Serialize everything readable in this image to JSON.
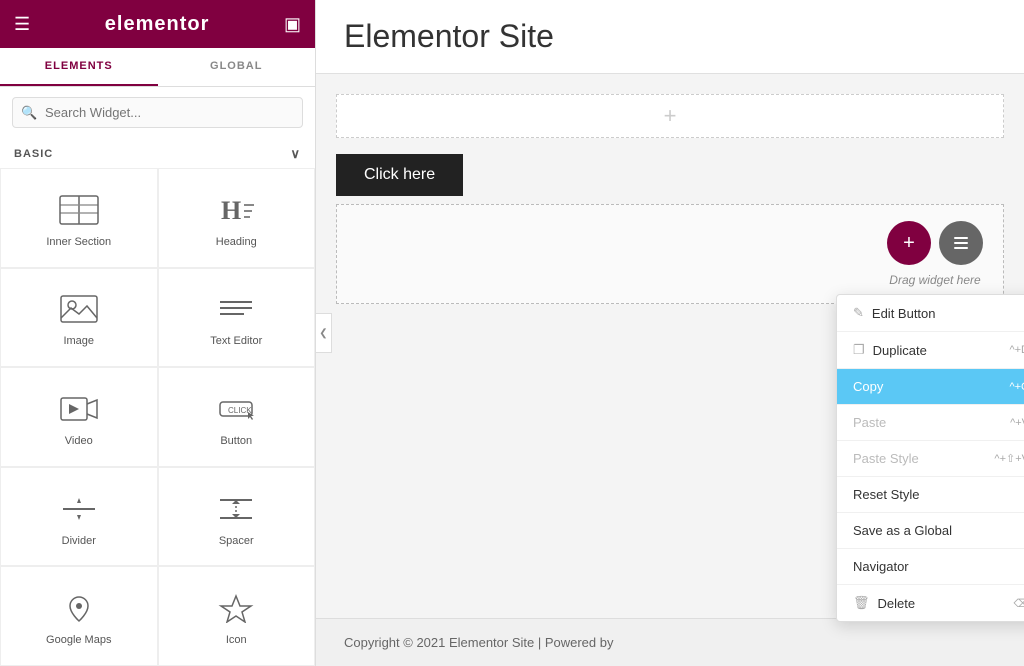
{
  "sidebar": {
    "logo": "elementor",
    "tabs": [
      {
        "id": "elements",
        "label": "ELEMENTS",
        "active": true
      },
      {
        "id": "global",
        "label": "GLOBAL",
        "active": false
      }
    ],
    "search": {
      "placeholder": "Search Widget..."
    },
    "section_label": "BASIC",
    "widgets": [
      {
        "id": "inner-section",
        "label": "Inner Section",
        "icon": "inner-section-icon"
      },
      {
        "id": "heading",
        "label": "Heading",
        "icon": "heading-icon"
      },
      {
        "id": "image",
        "label": "Image",
        "icon": "image-icon"
      },
      {
        "id": "text-editor",
        "label": "Text Editor",
        "icon": "text-editor-icon"
      },
      {
        "id": "video",
        "label": "Video",
        "icon": "video-icon"
      },
      {
        "id": "button",
        "label": "Button",
        "icon": "button-icon"
      },
      {
        "id": "divider",
        "label": "Divider",
        "icon": "divider-icon"
      },
      {
        "id": "spacer",
        "label": "Spacer",
        "icon": "spacer-icon"
      },
      {
        "id": "google-maps",
        "label": "Google Maps",
        "icon": "map-icon"
      },
      {
        "id": "icon",
        "label": "Icon",
        "icon": "icon-icon"
      }
    ]
  },
  "main": {
    "title": "Elementor Site",
    "canvas": {
      "add_section_plus": "+",
      "button_label": "Click here",
      "drag_label": "Drag widget here"
    },
    "context_menu": {
      "items": [
        {
          "id": "edit-button",
          "label": "Edit Button",
          "shortcut": "",
          "icon": "edit-icon",
          "active": false,
          "disabled": false
        },
        {
          "id": "duplicate",
          "label": "Duplicate",
          "shortcut": "^+D",
          "icon": "duplicate-icon",
          "active": false,
          "disabled": false
        },
        {
          "id": "copy",
          "label": "Copy",
          "shortcut": "^+C",
          "icon": "",
          "active": true,
          "disabled": false
        },
        {
          "id": "paste",
          "label": "Paste",
          "shortcut": "^+V",
          "icon": "",
          "active": false,
          "disabled": true
        },
        {
          "id": "paste-style",
          "label": "Paste Style",
          "shortcut": "^+⇧+V",
          "icon": "",
          "active": false,
          "disabled": true
        },
        {
          "id": "reset-style",
          "label": "Reset Style",
          "shortcut": "",
          "icon": "",
          "active": false,
          "disabled": false
        },
        {
          "id": "save-as-global",
          "label": "Save as a Global",
          "shortcut": "",
          "icon": "",
          "active": false,
          "disabled": false
        },
        {
          "id": "navigator",
          "label": "Navigator",
          "shortcut": "",
          "icon": "",
          "active": false,
          "disabled": false
        },
        {
          "id": "delete",
          "label": "Delete",
          "shortcut": "⌫",
          "icon": "trash-icon",
          "active": false,
          "disabled": false
        }
      ]
    },
    "footer_text": "Copyright © 2021 Elementor Site | Powered by"
  },
  "colors": {
    "brand": "#800040",
    "copy_active": "#5bc8f5",
    "button_dark": "#222222"
  }
}
